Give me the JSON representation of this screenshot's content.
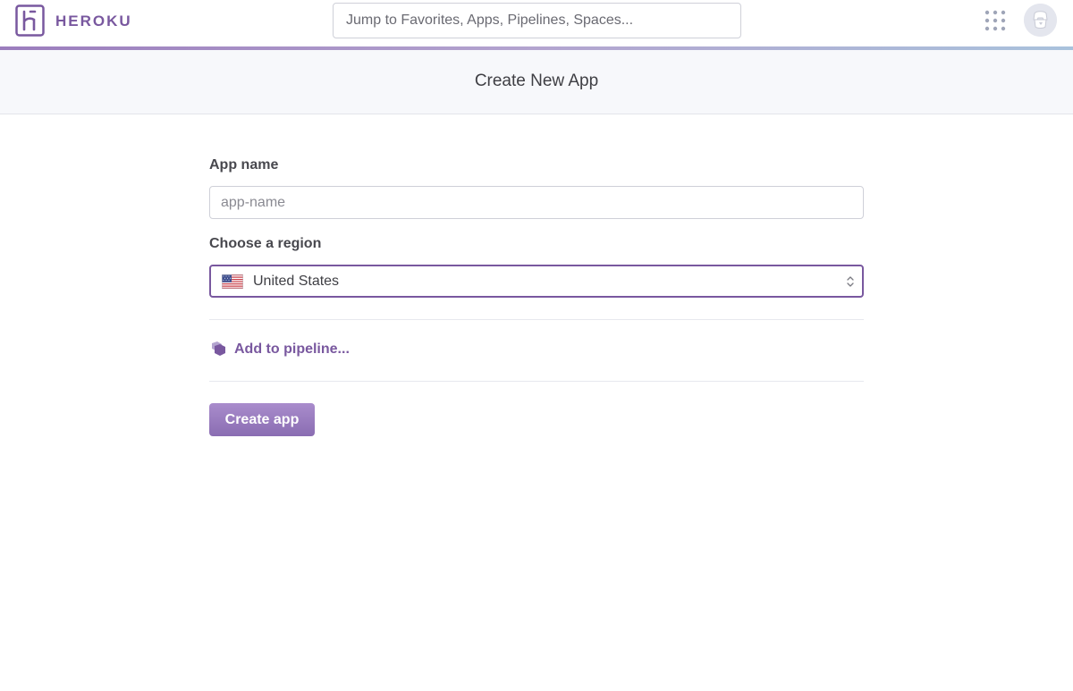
{
  "header": {
    "brand": "HEROKU",
    "search_placeholder": "Jump to Favorites, Apps, Pipelines, Spaces..."
  },
  "page": {
    "title": "Create New App"
  },
  "form": {
    "app_name_label": "App name",
    "app_name_placeholder": "app-name",
    "app_name_value": "",
    "region_label": "Choose a region",
    "region_value": "United States",
    "pipeline_link": "Add to pipeline...",
    "submit_label": "Create app"
  },
  "icons": {
    "logo": "heroku-logo-icon",
    "apps": "apps-grid-icon",
    "avatar": "user-avatar-icon",
    "flag": "us-flag-icon",
    "select": "chevron-updown-icon",
    "pipeline": "pipeline-icon"
  },
  "colors": {
    "brand": "#79589f",
    "button_top": "#a98ccc",
    "button_bottom": "#8a6db2",
    "focus_border": "#79589f"
  }
}
